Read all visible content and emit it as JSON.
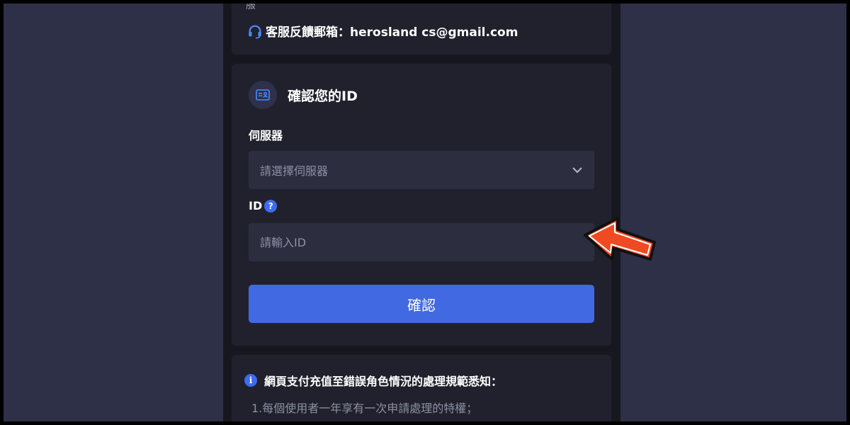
{
  "contact": {
    "cut_text": "服 ˅",
    "email_label": "客服反饋郵箱：herosland cs@gmail.com",
    "icon": "headset-icon"
  },
  "verify": {
    "title": "確認您的ID",
    "title_icon": "id-card-icon",
    "server_label": "伺服器",
    "server_placeholder": "請選擇伺服器",
    "id_label": "ID",
    "id_help": "?",
    "id_placeholder": "請輸入ID",
    "confirm_label": "確認"
  },
  "notice": {
    "icon_text": "i",
    "title": "網頁支付充值至錯誤角色情況的處理規範悉知：",
    "line1": "1.每個使用者一年享有一次申請處理的特權；"
  },
  "colors": {
    "page_bg": "#2e3047",
    "column_bg": "#17181f",
    "card_bg": "#20212d",
    "field_bg": "#2c2e40",
    "accent": "#4169e1",
    "arrow": "#f04a23"
  }
}
